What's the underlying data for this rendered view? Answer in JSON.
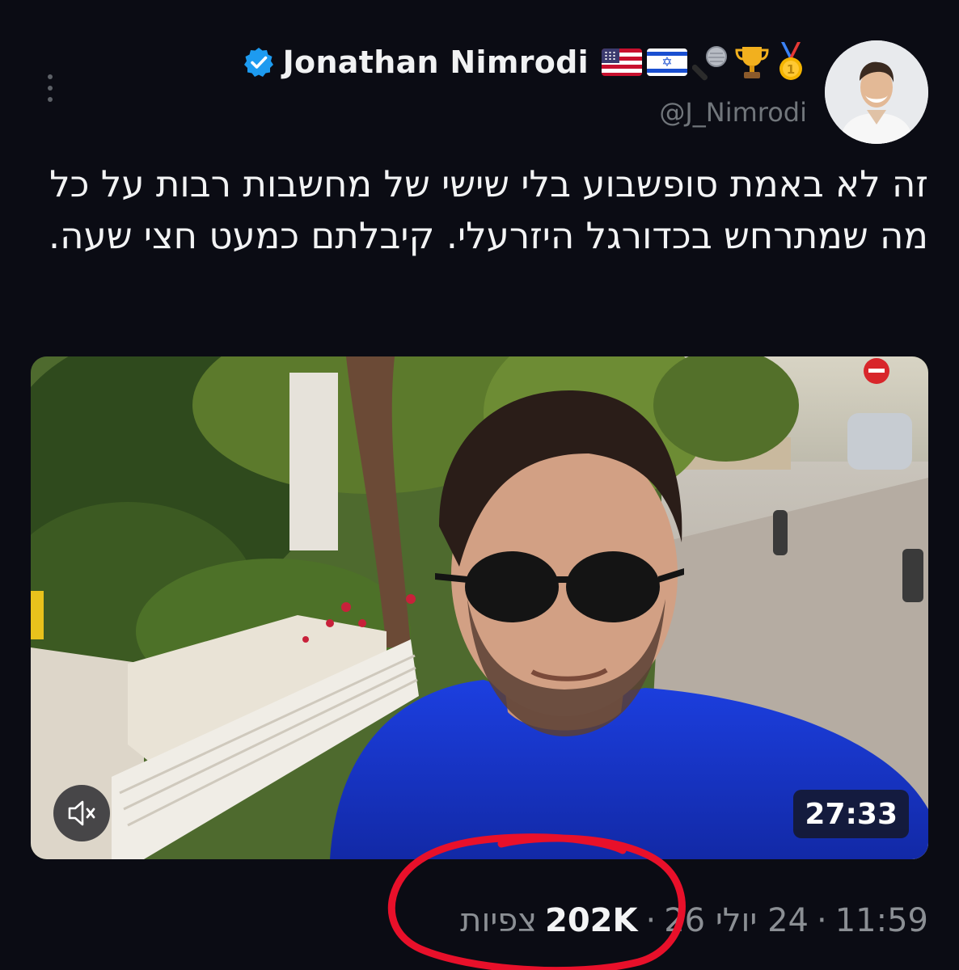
{
  "author": {
    "display_name": "Jonathan Nimrodi",
    "handle": "@J_Nimrodi",
    "verified": true,
    "name_emojis": [
      "flag-us-icon",
      "flag-il-icon",
      "microphone-icon",
      "trophy-icon",
      "gold-medal-icon"
    ]
  },
  "tweet": {
    "text": "זה לא באמת סופשבוע בלי שישי של מחשבות רבות על כל מה שמתרחש בכדורגל היזרעלי. קיבלתם כמעט חצי שעה."
  },
  "media": {
    "type": "video",
    "duration": "27:33",
    "muted": true
  },
  "meta": {
    "time": "11:59",
    "date": "24 יולי 26",
    "views_count": "202K",
    "views_label": "צפיות"
  },
  "colors": {
    "background": "#0b0c14",
    "verified_blue": "#1d9bf0",
    "annotation_red": "#e8102a"
  }
}
